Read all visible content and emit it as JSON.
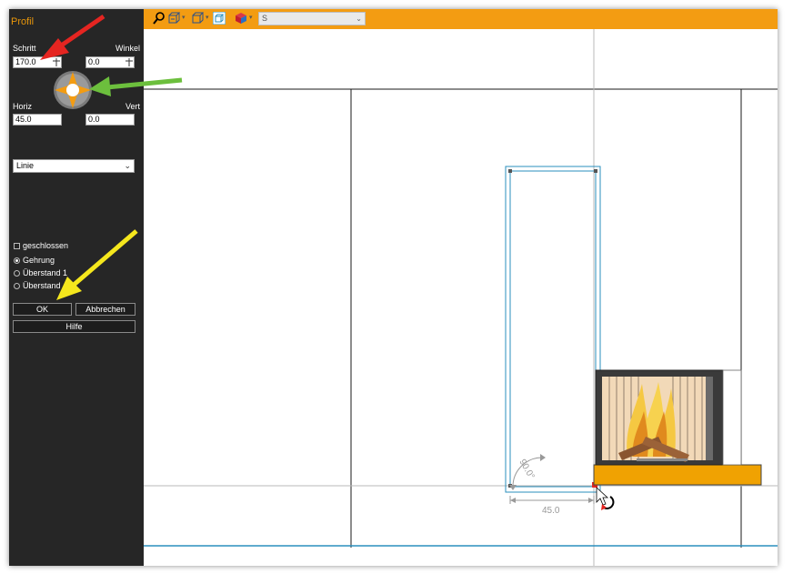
{
  "panel": {
    "title": "Profil",
    "schritt_label": "Schritt",
    "schritt_value": "170.0",
    "winkel_label": "Winkel",
    "winkel_value": "0.0",
    "horiz_label": "Horiz",
    "horiz_value": "45.0",
    "vert_label": "Vert",
    "vert_value": "0.0",
    "line_type": "Linie",
    "closed_label": "geschlossen",
    "closed_checked": false,
    "options": [
      {
        "label": "Gehrung",
        "selected": true
      },
      {
        "label": "Überstand 1",
        "selected": false
      },
      {
        "label": "Überstand",
        "selected": false
      }
    ],
    "ok_label": "OK",
    "cancel_label": "Abbrechen",
    "help_label": "Hilfe"
  },
  "toolbar": {
    "icons": [
      "zoom-icon",
      "view-cube-icon",
      "view-cube-outline-icon",
      "view-3d-icon",
      "color-cube-icon"
    ],
    "select_value": "S"
  },
  "drawing": {
    "dimension_text": "45.0",
    "angle_text": "90.0°"
  },
  "colors": {
    "accent": "#f39c12",
    "panel_bg": "#262626",
    "selection": "#2a8fbd",
    "arrow_red": "#e52521",
    "arrow_green": "#6cbf3d",
    "arrow_yellow": "#f5e71d"
  }
}
